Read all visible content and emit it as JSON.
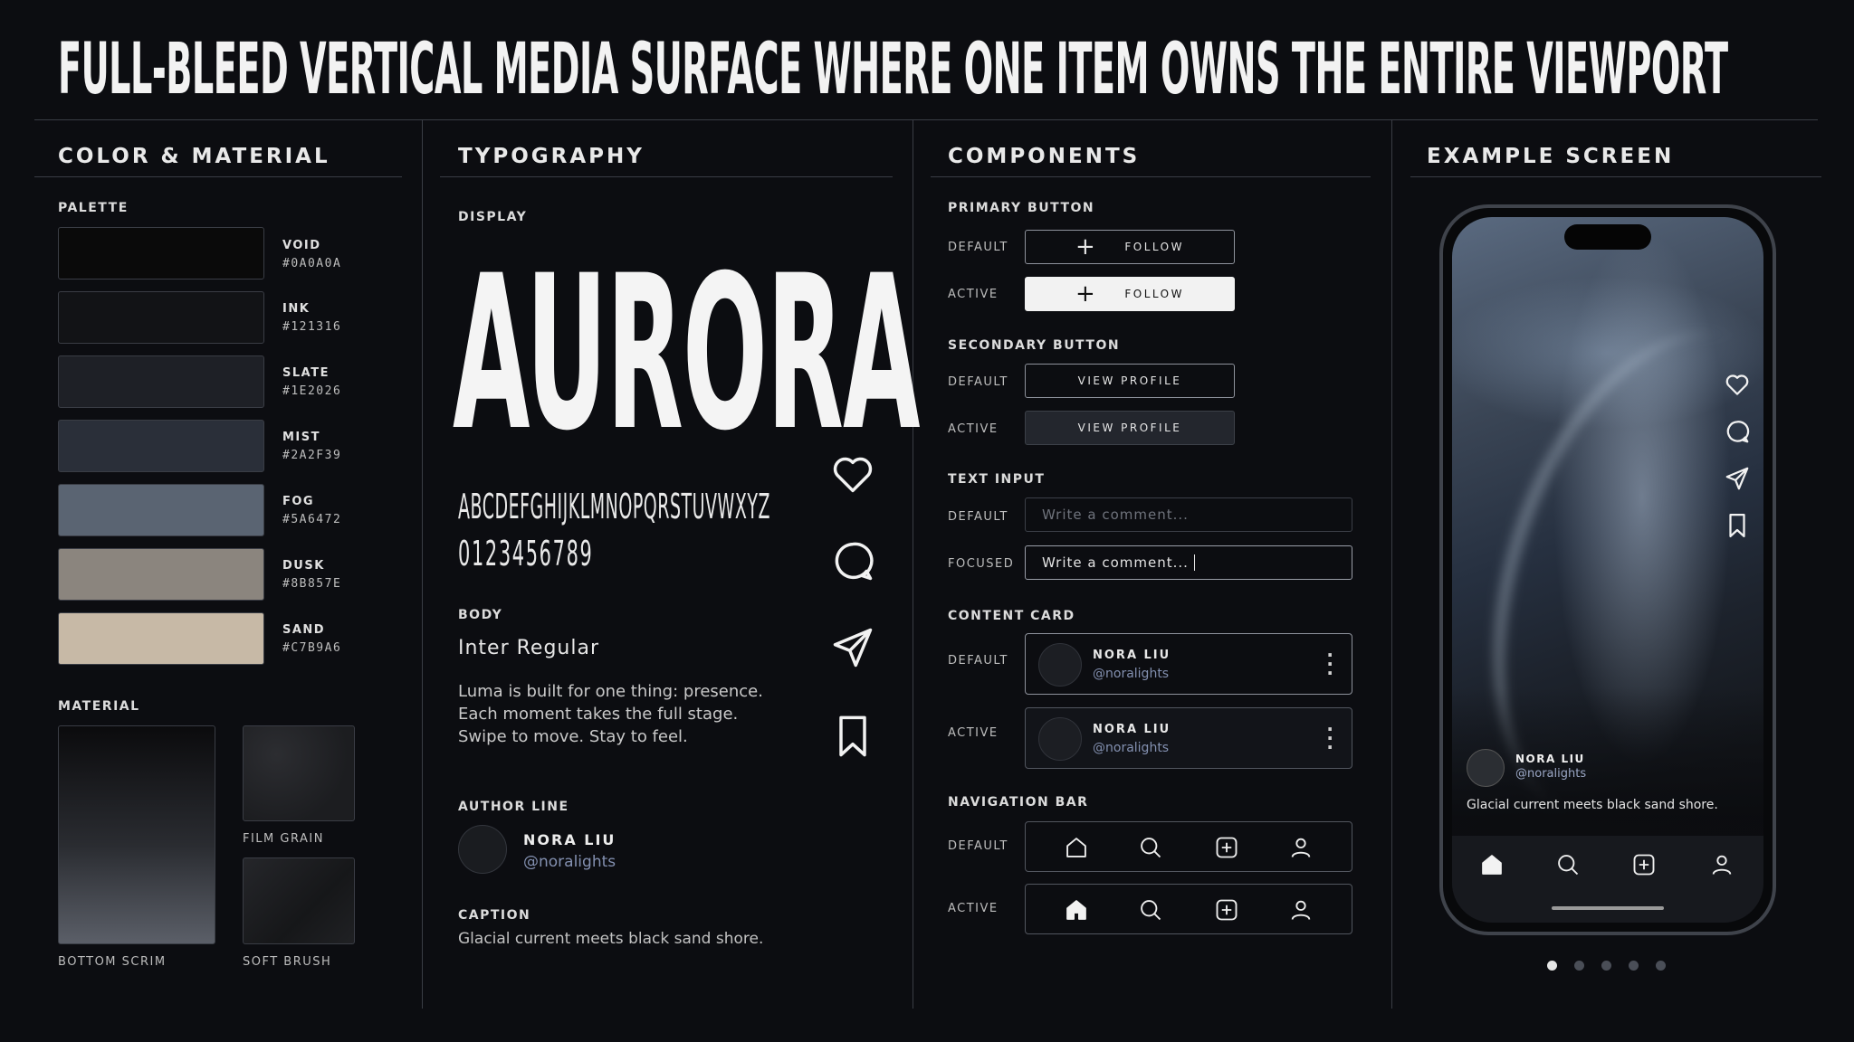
{
  "title": "FULL-BLEED VERTICAL MEDIA SURFACE WHERE ONE ITEM OWNS THE ENTIRE VIEWPORT",
  "sections": {
    "color": "COLOR & MATERIAL",
    "typography": "TYPOGRAPHY",
    "components": "COMPONENTS",
    "example": "EXAMPLE SCREEN"
  },
  "palette": {
    "label": "PALETTE",
    "swatches": [
      {
        "name": "VOID",
        "hex": "#0A0A0A",
        "color": "#0A0A0A"
      },
      {
        "name": "INK",
        "hex": "#121316",
        "color": "#121316"
      },
      {
        "name": "SLATE",
        "hex": "#1E2026",
        "color": "#1E2026"
      },
      {
        "name": "MIST",
        "hex": "#2A2F39",
        "color": "#2A2F39"
      },
      {
        "name": "FOG",
        "hex": "#5A6472",
        "color": "#5A6472"
      },
      {
        "name": "DUSK",
        "hex": "#8B857E",
        "color": "#8B857E"
      },
      {
        "name": "SAND",
        "hex": "#C7B9A6",
        "color": "#C7B9A6"
      }
    ]
  },
  "material": {
    "label": "MATERIAL",
    "bottom_scrim": "BOTTOM SCRIM",
    "film_grain": "FILM GRAIN",
    "soft_brush": "SOFT BRUSH"
  },
  "typography": {
    "display_label": "DISPLAY",
    "display_word": "AURORA",
    "alphabet": "ABCDEFGHIJKLMNOPQRSTUVWXYZ",
    "digits": "0123456789",
    "body_label": "BODY",
    "body_font": "Inter Regular",
    "body_lines": [
      "Luma is built for one thing: presence.",
      "Each moment takes the full stage.",
      "Swipe to move. Stay to feel."
    ],
    "author_label": "AUTHOR LINE",
    "author_name": "NORA LIU",
    "author_handle": "@noralights",
    "caption_label": "CAPTION",
    "caption": "Glacial current meets black sand shore."
  },
  "components": {
    "primary_label": "PRIMARY BUTTON",
    "secondary_label": "SECONDARY BUTTON",
    "input_label": "TEXT INPUT",
    "card_label": "CONTENT CARD",
    "nav_label": "NAVIGATION BAR",
    "state_default": "DEFAULT",
    "state_active": "ACTIVE",
    "state_focused": "FOCUSED",
    "follow": "FOLLOW",
    "view_profile": "VIEW PROFILE",
    "input_placeholder": "Write a comment...",
    "input_value": "Write a comment...",
    "card_name": "NORA LIU",
    "card_handle": "@noralights"
  },
  "phone": {
    "name": "NORA LIU",
    "handle": "@noralights",
    "caption": "Glacial current meets black sand shore.",
    "page_dots": 5,
    "active_dot": 0
  }
}
